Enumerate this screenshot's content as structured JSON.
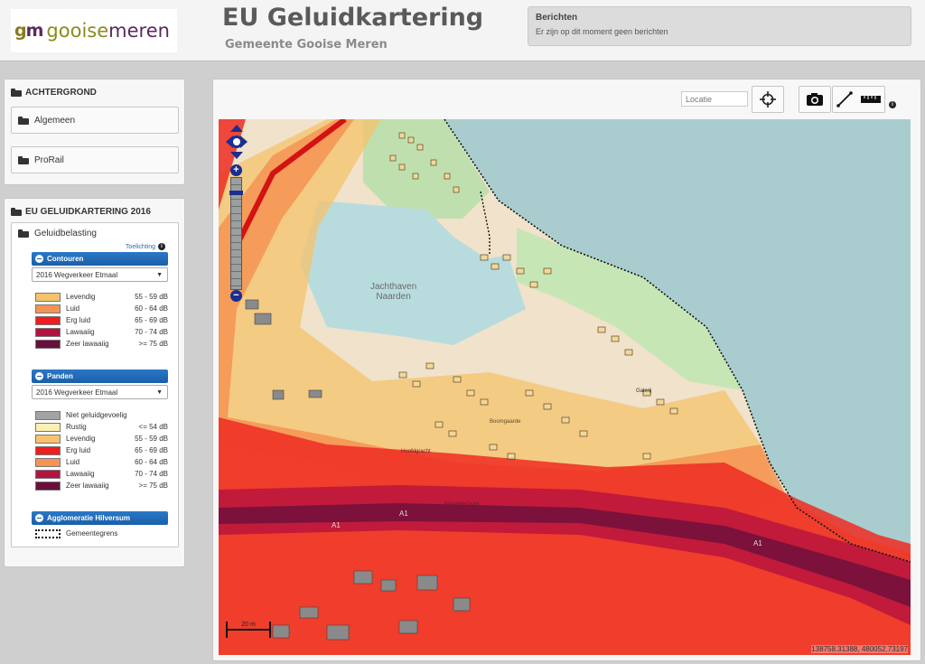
{
  "header": {
    "logo_mark_g": "g",
    "logo_mark_m": "m",
    "logo_word_a": "gooise",
    "logo_word_b": "meren",
    "title": "EU Geluidkartering",
    "subtitle": "Gemeente Gooise Meren",
    "messages_title": "Berichten",
    "messages_text": "Er zijn op dit moment geen berichten"
  },
  "background_panel": {
    "title": "ACHTERGROND",
    "items": [
      {
        "label": "Algemeen"
      },
      {
        "label": "ProRail"
      }
    ]
  },
  "mapping_panel": {
    "title": "EU GELUIDKARTERING 2016",
    "group_label": "Geluidbelasting",
    "toelichting": "Toelichting",
    "contours": {
      "header": "Contouren",
      "selected": "2016 Wegverkeer Etmaal",
      "legend": [
        {
          "label": "Levendig",
          "range": "55 - 59 dB",
          "color": "#f6c36b"
        },
        {
          "label": "Luid",
          "range": "60 - 64 dB",
          "color": "#f49454"
        },
        {
          "label": "Erg luid",
          "range": "65 - 69 dB",
          "color": "#ef1d1d"
        },
        {
          "label": "Lawaaiig",
          "range": "70 - 74 dB",
          "color": "#b5123f"
        },
        {
          "label": "Zeer lawaaiig",
          "range": ">= 75 dB",
          "color": "#6a0f3c"
        }
      ]
    },
    "panden": {
      "header": "Panden",
      "selected": "2016 Wegverkeer Etmaal",
      "legend": [
        {
          "label": "Niet geluidgevoelig",
          "range": "",
          "color": "#a3a3a3"
        },
        {
          "label": "Rustig",
          "range": "<= 54 dB",
          "color": "#fbf1b2"
        },
        {
          "label": "Levendig",
          "range": "55 - 59 dB",
          "color": "#f6c36b"
        },
        {
          "label": "Erg luid",
          "range": "65 - 69 dB",
          "color": "#ef1d1d"
        },
        {
          "label": "Luid",
          "range": "60 - 64 dB",
          "color": "#f49454"
        },
        {
          "label": "Lawaaiig",
          "range": "70 - 74 dB",
          "color": "#b5123f"
        },
        {
          "label": "Zeer lawaaiig",
          "range": ">= 75 dB",
          "color": "#6a0f3c"
        }
      ]
    },
    "agglomeratie": {
      "header": "Agglomeratie Hilversum",
      "legend_label": "Gemeentegrens"
    }
  },
  "toolbar": {
    "location_placeholder": "Locatie"
  },
  "map": {
    "coordinates": "138758.31388, 480052.73197",
    "labels": {
      "harbor_1": "Jachthaven",
      "harbor_2": "Naarden",
      "road_1": "A1",
      "road_2": "A1",
      "road_3": "A1",
      "street_1": "Noorderlaan",
      "street_2": "Boomgaarde",
      "street_3": "Hoofdgracht",
      "street_4": "Galerij",
      "scale": "20 m"
    }
  }
}
